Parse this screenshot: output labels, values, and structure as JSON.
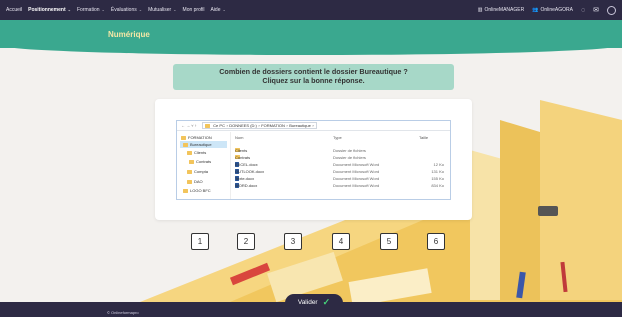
{
  "topnav": {
    "items": [
      {
        "label": "Accueil",
        "active": false,
        "chevron": false
      },
      {
        "label": "Positionnement",
        "active": true,
        "chevron": true
      },
      {
        "label": "Formation",
        "active": false,
        "chevron": true
      },
      {
        "label": "Évaluations",
        "active": false,
        "chevron": true
      },
      {
        "label": "Mutualiser",
        "active": false,
        "chevron": true
      },
      {
        "label": "Mon profil",
        "active": false,
        "chevron": false
      },
      {
        "label": "Aide",
        "active": false,
        "chevron": true
      }
    ],
    "manager_label": "OnlineMANAGER",
    "agora_label": "OnlineAGORA",
    "icons": [
      "chat-icon",
      "mail-icon",
      "user-circle-icon"
    ]
  },
  "banner": {
    "title": "Numérique"
  },
  "question": {
    "line1": "Combien de dossiers contient le dossier Bureautique ?",
    "line2": "Cliquez sur la bonne réponse."
  },
  "explorer": {
    "nav": "← → ˅ ↑",
    "path": [
      "Ce PC",
      "DONNEES (D:)",
      "FORMATION",
      "Bureautique"
    ],
    "tree": [
      {
        "label": "FORMATION",
        "selected": false
      },
      {
        "label": "Bureautique",
        "selected": true
      },
      {
        "label": "Clients",
        "selected": false
      },
      {
        "label": "Contrats",
        "selected": false
      },
      {
        "label": "Compta",
        "selected": false
      },
      {
        "label": "DAO",
        "selected": false
      },
      {
        "label": "LOGO BFC",
        "selected": false
      }
    ],
    "headers": {
      "name": "Nom",
      "type": "Type",
      "size": "Taille"
    },
    "rows": [
      {
        "name": "Clients",
        "icon": "folder-icon",
        "type": "Dossier de fichiers",
        "size": ""
      },
      {
        "name": "Contrats",
        "icon": "folder-icon",
        "type": "Dossier de fichiers",
        "size": ""
      },
      {
        "name": "EXCEL.docx",
        "icon": "word-doc-icon",
        "type": "Document Microsoft Word",
        "size": "12 Ko"
      },
      {
        "name": "OUTLOOK.docx",
        "icon": "word-doc-icon",
        "type": "Document Microsoft Word",
        "size": "131 Ko"
      },
      {
        "name": "Texte.docx",
        "icon": "word-doc-icon",
        "type": "Document Microsoft Word",
        "size": "155 Ko"
      },
      {
        "name": "WORD.docx",
        "icon": "word-doc-icon",
        "type": "Document Microsoft Word",
        "size": "834 Ko"
      }
    ]
  },
  "answers": [
    "1",
    "2",
    "3",
    "4",
    "5",
    "6"
  ],
  "validate_label": "Valider",
  "footer": {
    "copyright": "© Onlineformapro"
  },
  "colors": {
    "nav": "#2d2a44",
    "banner": "#3aa88f",
    "title": "#f5e7a6",
    "question_bg": "#a7d8c8",
    "folder": "#f2c45b",
    "check": "#45d27a"
  }
}
